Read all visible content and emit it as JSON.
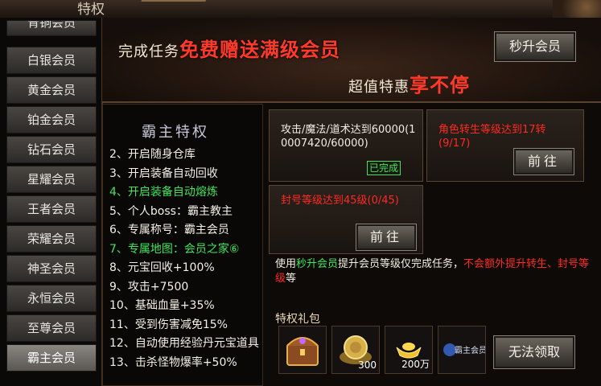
{
  "window": {
    "title": "特权"
  },
  "sidebar": {
    "items": [
      {
        "label": "青铜会员"
      },
      {
        "label": "白银会员"
      },
      {
        "label": "黄金会员"
      },
      {
        "label": "铂金会员"
      },
      {
        "label": "钻石会员"
      },
      {
        "label": "星耀会员"
      },
      {
        "label": "王者会员"
      },
      {
        "label": "荣耀会员"
      },
      {
        "label": "神圣会员"
      },
      {
        "label": "永恒会员"
      },
      {
        "label": "至尊会员"
      },
      {
        "label": "霸主会员"
      }
    ],
    "active": "霸主会员"
  },
  "banner": {
    "line1_a": "完成任务",
    "line1_b": "免费赠送满级会员",
    "line2_a": "超值特惠",
    "line2_b": "享不停",
    "upgrade_button": "秒升会员"
  },
  "privileges": {
    "title": "霸主特权",
    "items": [
      {
        "text": "2、开启随身仓库",
        "green": false
      },
      {
        "text": "3、开启装备自动回收",
        "green": false
      },
      {
        "text": "4、开启装备自动熔炼",
        "green": true
      },
      {
        "text": "5、个人boss：霸主教主",
        "green": false
      },
      {
        "text": "6、专属称号：霸主会员",
        "green": false
      },
      {
        "text": "7、专属地图：会员之家⑥",
        "green": true
      },
      {
        "text": "8、元宝回收+100%",
        "green": false
      },
      {
        "text": "9、攻击+7500",
        "green": false
      },
      {
        "text": "10、基础血量+35%",
        "green": false
      },
      {
        "text": "11、受到伤害减免15%",
        "green": false
      },
      {
        "text": "12、自动使用经验丹元宝道具",
        "green": false
      },
      {
        "text": "13、击杀怪物爆率+50%",
        "green": false
      }
    ]
  },
  "tasks": {
    "t1": {
      "text": "攻击/魔法/道术达到60000(10007420/60000)",
      "status": "已完成"
    },
    "t2": {
      "text": "角色转生等级达到17转(9/17)",
      "button": "前往"
    },
    "t3": {
      "text": "封号等级达到45级(0/45)",
      "button": "前往"
    }
  },
  "info": {
    "p1": "使用",
    "p2": "秒升会员",
    "p3": "提升会员等级仅完成任务，",
    "p4": "不会额外提升转生、封号等级",
    "p5": "等"
  },
  "gift": {
    "label": "特权礼包",
    "items": [
      {
        "icon": "treasure-chest-icon",
        "count": ""
      },
      {
        "icon": "gold-coin-icon",
        "count": "300"
      },
      {
        "icon": "gold-ingot-icon",
        "count": "200万"
      },
      {
        "icon": "vip-title-icon",
        "count": ""
      }
    ],
    "claim_button": "无法领取",
    "title_badge": "霸主会员"
  }
}
